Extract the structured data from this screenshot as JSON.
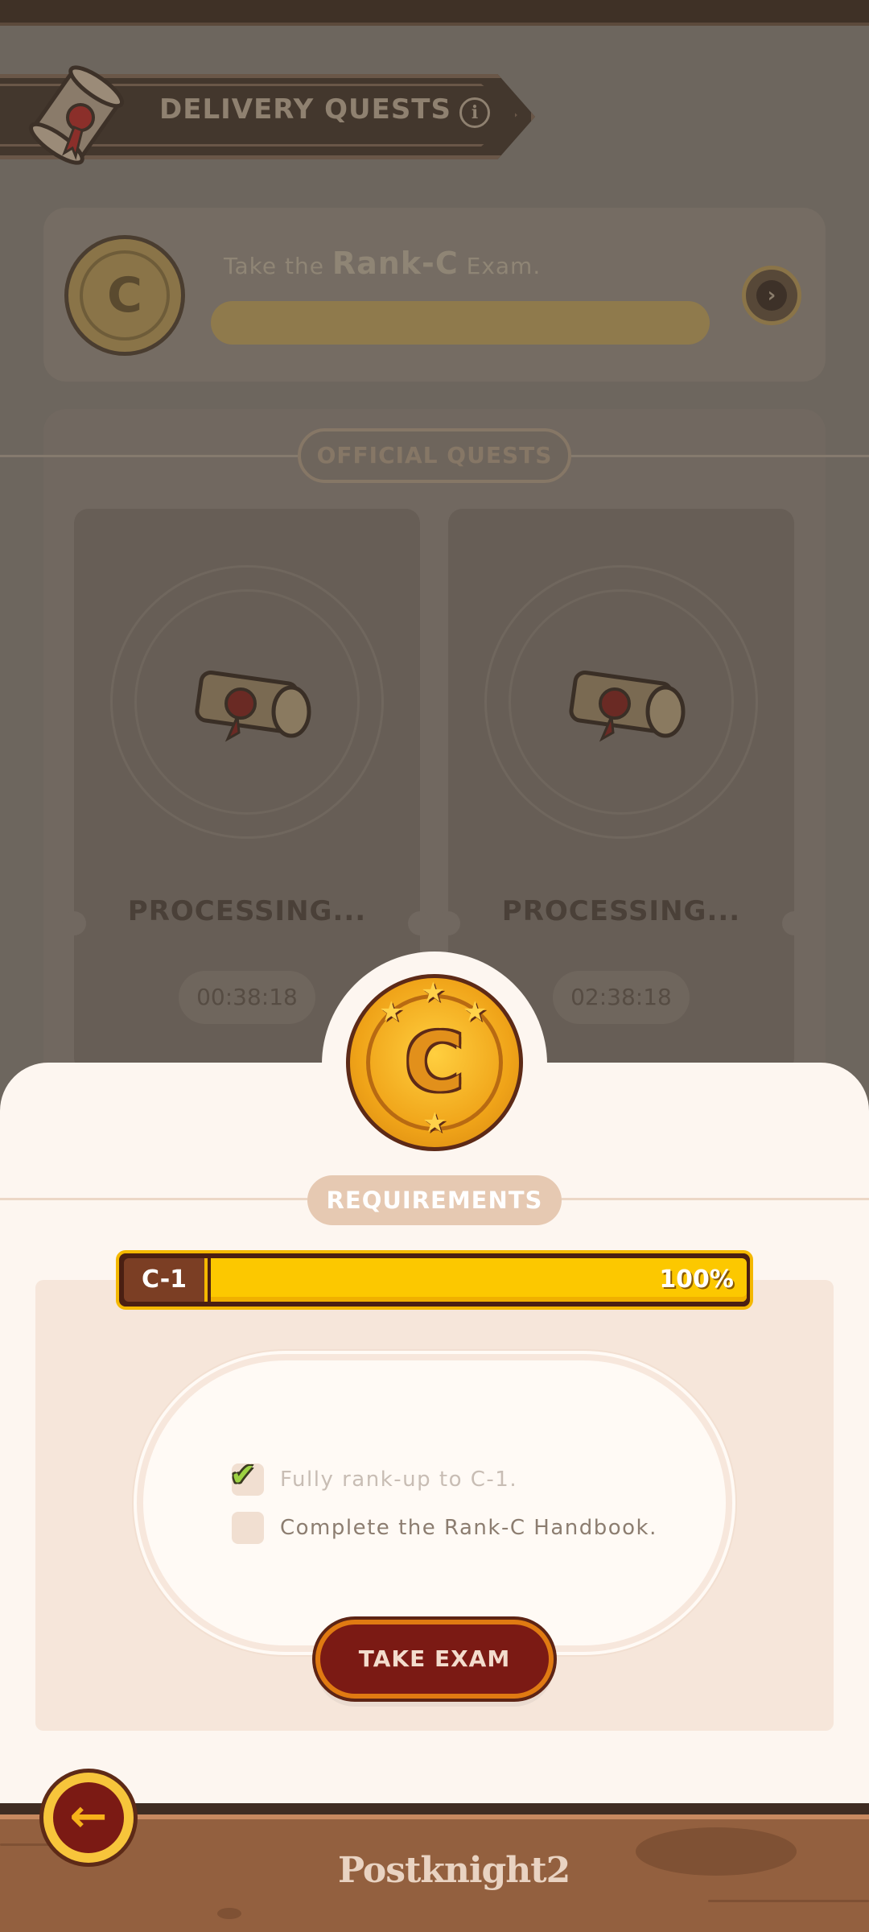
{
  "header": {
    "title": "DELIVERY QUESTS",
    "info_icon": "info-icon",
    "banner_icon": "scroll-icon"
  },
  "rank_card": {
    "text_prefix": "Take the",
    "rank": "Rank-C",
    "text_suffix": "Exam.",
    "medal_letter": "C",
    "next_icon": "chevron-right-icon"
  },
  "official_quests": {
    "title": "OFFICIAL QUESTS",
    "cards": [
      {
        "status": "PROCESSING...",
        "timer": "00:38:18"
      },
      {
        "status": "PROCESSING...",
        "timer": "02:38:18"
      }
    ]
  },
  "sheet": {
    "medal_letter": "C",
    "requirements_title": "REQUIREMENTS",
    "progress": {
      "level": "C-1",
      "percent_label": "100%",
      "fraction": 1.0
    },
    "requirements": [
      {
        "label": "Fully rank-up to C-1.",
        "done": true
      },
      {
        "label": "Complete the Rank-C Handbook.",
        "done": false
      }
    ],
    "take_exam_label": "TAKE EXAM"
  },
  "footer": {
    "logo": "Postknight2",
    "back_icon": "arrow-left-icon"
  },
  "colors": {
    "accent_gold": "#fcc800",
    "exam_button": "#7b1a14",
    "sheet_bg": "#fdf6f0"
  }
}
